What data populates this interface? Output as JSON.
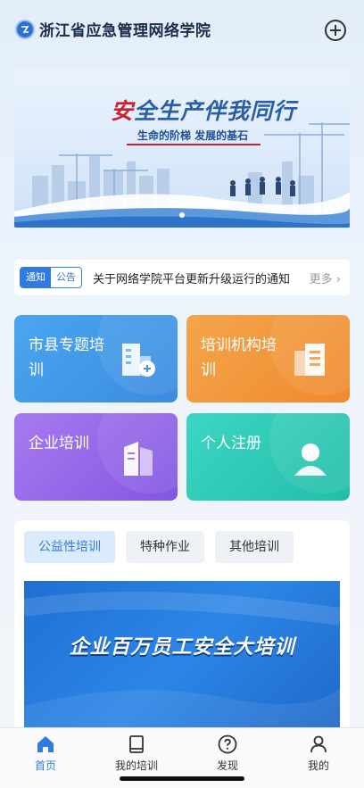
{
  "header": {
    "app_title": "浙江省应急管理网络学院",
    "logo_icon": "academy-logo-icon",
    "add_icon": "plus-circle-icon"
  },
  "banner": {
    "title_red": "安",
    "title_blue": "全生产伴我同行",
    "subtitle": "生命的阶梯 发展的基石",
    "page_index": 1,
    "page_count": 1
  },
  "notice": {
    "tag_primary": "通知",
    "tag_secondary": "公告",
    "text": "关于网络学院平台更新升级运行的通知",
    "more_label": "更多 ›"
  },
  "tiles": [
    {
      "label": "市县专题培训",
      "icon": "building-add-icon",
      "color": "#4ba6ef"
    },
    {
      "label": "培训机构培训",
      "icon": "office-building-icon",
      "color": "#f5a54c"
    },
    {
      "label": "企业培训",
      "icon": "enterprise-icon",
      "color": "#a87af0"
    },
    {
      "label": "个人注册",
      "icon": "user-register-icon",
      "color": "#3dd5c3"
    }
  ],
  "training": {
    "tabs": [
      {
        "label": "公益性培训",
        "active": true
      },
      {
        "label": "特种作业",
        "active": false
      },
      {
        "label": "其他培训",
        "active": false
      }
    ],
    "poster_text": "企业百万员工安全大培训"
  },
  "bottom_nav": [
    {
      "label": "首页",
      "icon": "home-icon",
      "active": true
    },
    {
      "label": "我的培训",
      "icon": "book-icon",
      "active": false
    },
    {
      "label": "发现",
      "icon": "question-circle-icon",
      "active": false
    },
    {
      "label": "我的",
      "icon": "person-icon",
      "active": false
    }
  ],
  "colors": {
    "accent": "#2f7be0",
    "banner_title_red": "#c8232e"
  }
}
